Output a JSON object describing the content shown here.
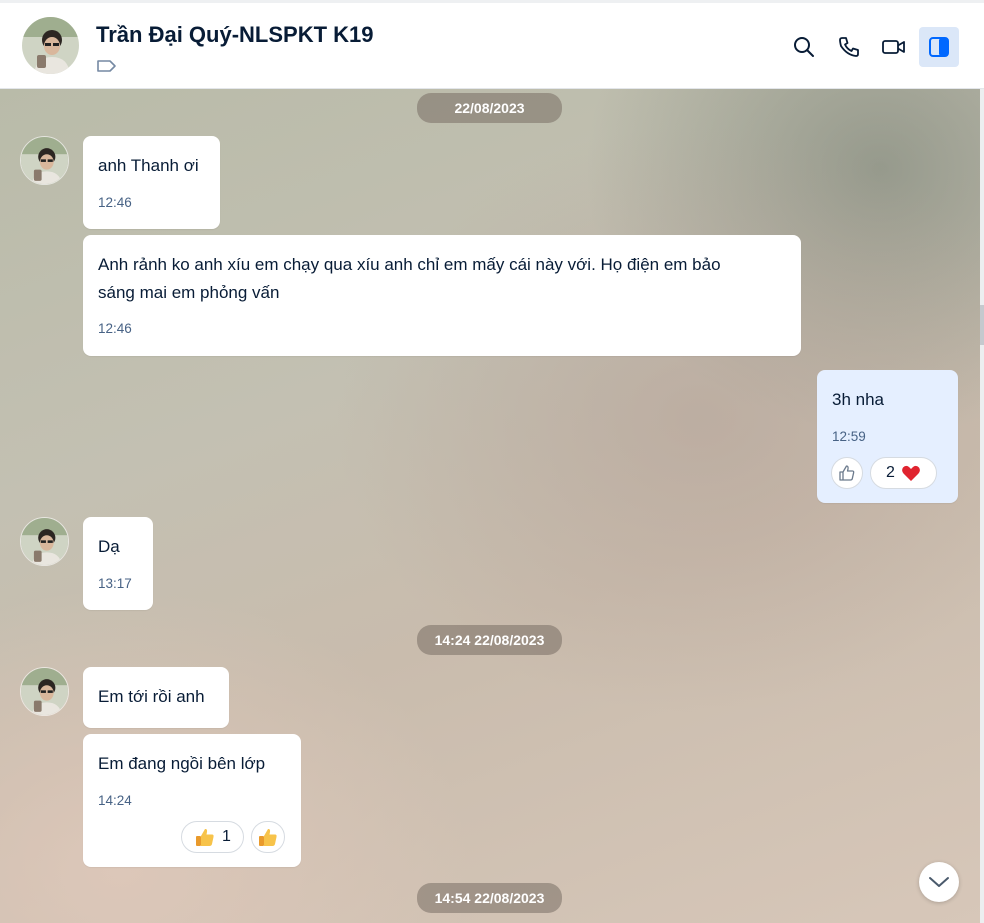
{
  "header": {
    "contact_name": "Trần Đại Quý-NLSPKT K19",
    "icons": [
      "avatar",
      "tag-icon",
      "search-icon",
      "phone-icon",
      "video-call-icon",
      "toggle-sidebar-icon"
    ]
  },
  "colors": {
    "my_bubble": "#e5efff",
    "their_bubble": "#ffffff",
    "accent": "#0068ff",
    "heart": "#e0242f",
    "text": "#081c36",
    "time": "#476285"
  },
  "date_separators": {
    "first": "22/08/2023",
    "second": "14:24 22/08/2023",
    "third": "14:54 22/08/2023"
  },
  "messages": [
    {
      "sender": "other",
      "text": "anh Thanh ơi",
      "time": "12:46"
    },
    {
      "sender": "other",
      "text_line1": "Anh rảnh ko anh xíu em chạy qua xíu anh chỉ em mấy cái này với. Họ điện em bảo",
      "text_line2": "sáng mai em phỏng vấn",
      "time": "12:46"
    },
    {
      "sender": "me",
      "text": "3h nha",
      "time": "12:59",
      "reaction_count": "2"
    },
    {
      "sender": "other",
      "text": "Dạ",
      "time": "13:17"
    },
    {
      "sender": "other",
      "text": "Em tới rồi anh"
    },
    {
      "sender": "other",
      "text": "Em đang ngồi bên lớp",
      "time": "14:24",
      "reaction_count": "1"
    }
  ]
}
